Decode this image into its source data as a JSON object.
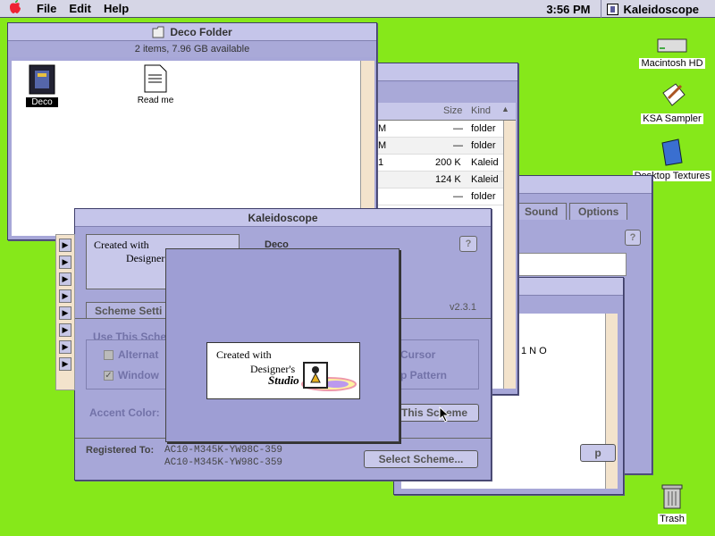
{
  "menubar": {
    "apple": "",
    "items": [
      "File",
      "Edit",
      "Help"
    ],
    "clock": "3:56 PM",
    "app_name": "Kaleidoscope"
  },
  "desktop_icons": {
    "hd": "Macintosh HD",
    "sampler": "KSA Sampler",
    "textures": "Desktop Textures",
    "trash": "Trash"
  },
  "deco_folder": {
    "title": "Deco Folder",
    "status": "2 items, 7.96 GB available",
    "items": [
      "Deco",
      "Read me"
    ]
  },
  "list_window": {
    "col_size": "Size",
    "col_kind": "Kind",
    "rows": [
      {
        "c": "M",
        "size": "—",
        "kind": "folder"
      },
      {
        "c": "M",
        "size": "—",
        "kind": "folder"
      },
      {
        "c": "1",
        "size": "200 K",
        "kind": "Kaleid"
      },
      {
        "c": "",
        "size": "124 K",
        "kind": "Kaleid"
      },
      {
        "c": "",
        "size": "—",
        "kind": "folder"
      }
    ]
  },
  "options_window": {
    "tabs": [
      "Sound",
      "Options"
    ],
    "item_label": "1 N O",
    "button": "p"
  },
  "kaleidoscope_window": {
    "title": "Kaleidoscope",
    "logo_text1": "Created with",
    "logo_text2": "Designer's",
    "logo_text3": "Studio",
    "scheme_name": "Deco",
    "version": "v2.3.1",
    "tab_scheme": "Scheme Setti",
    "use_scheme": "Use This Sche",
    "alternate": "Alternat",
    "window": "Window",
    "cursor": "Cursor",
    "pattern": "p Pattern",
    "accent": "Accent Color:",
    "use_btn": "This Scheme",
    "registered_label": "Registered To:",
    "reg_line1": "AC10-M345K-YW98C-359",
    "reg_line2": "AC10-M345K-YW98C-359",
    "select_btn": "Select Scheme..."
  },
  "splash": {
    "line1": "Created with",
    "line2": "Designer's",
    "line3": "Studio"
  }
}
